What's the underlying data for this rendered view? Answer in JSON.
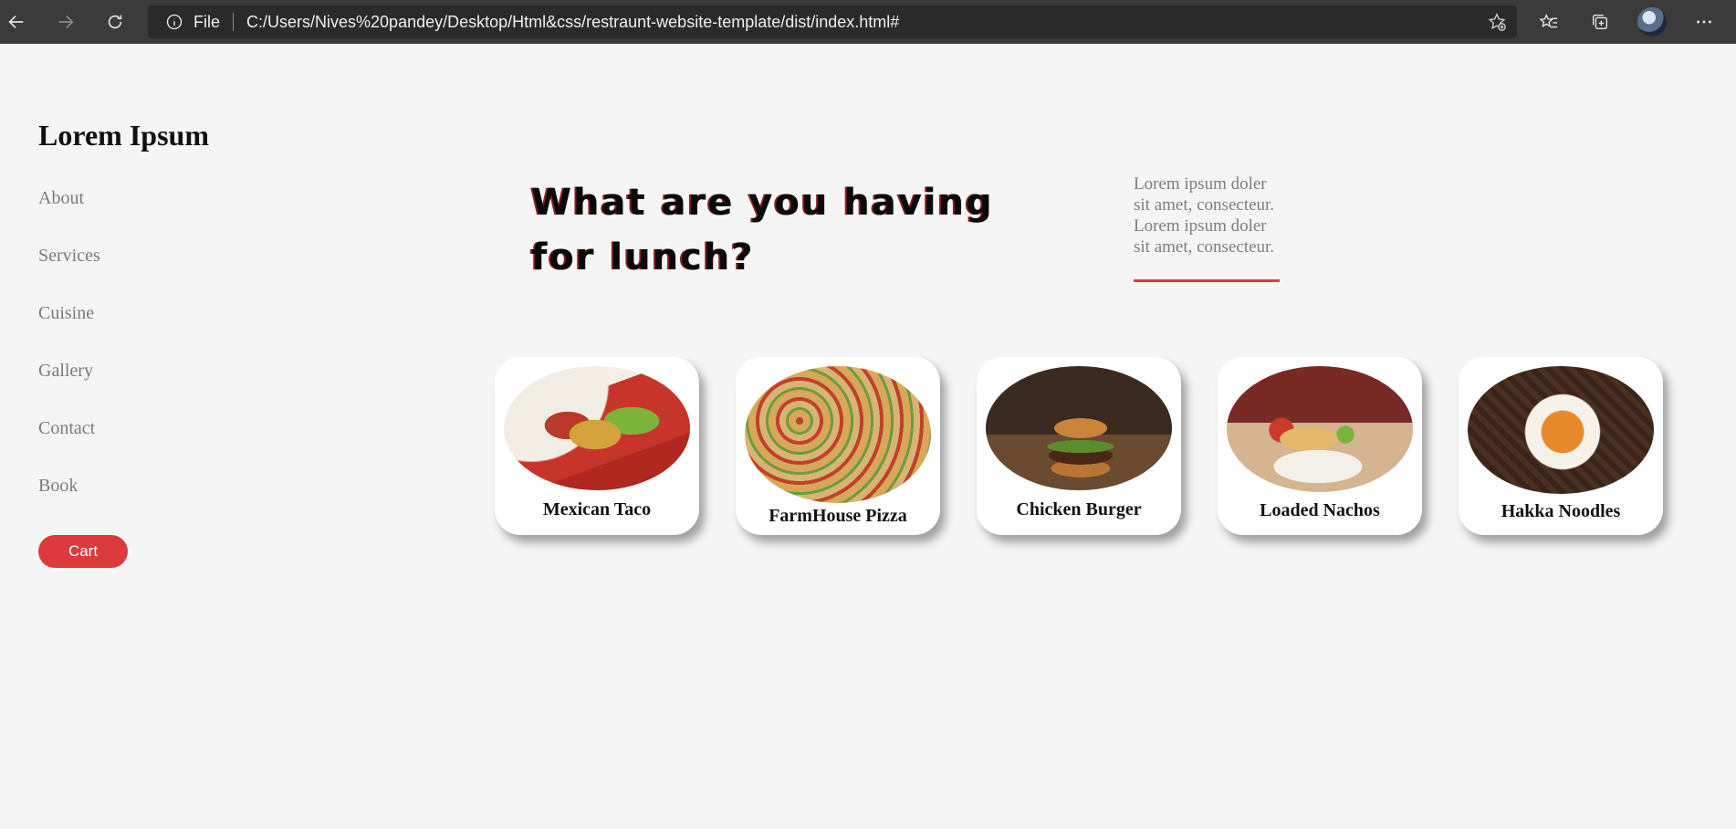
{
  "browser": {
    "file_label": "File",
    "url": "C:/Users/Nives%20pandey/Desktop/Html&css/restraunt-website-template/dist/index.html#",
    "icons": [
      "back-icon",
      "forward-icon",
      "refresh-icon",
      "info-icon",
      "add-favorite-icon",
      "favorites-icon",
      "collections-icon",
      "profile-avatar",
      "more-icon"
    ]
  },
  "sidebar": {
    "brand": "Lorem Ipsum",
    "items": [
      {
        "label": "About"
      },
      {
        "label": "Services"
      },
      {
        "label": "Cuisine"
      },
      {
        "label": "Gallery"
      },
      {
        "label": "Contact"
      },
      {
        "label": "Book"
      }
    ],
    "cart_label": "Cart"
  },
  "hero": {
    "title": "What are you having for lunch?",
    "description": "Lorem ipsum doler sit amet, consecteur. Lorem ipsum doler sit amet, consecteur."
  },
  "dishes": [
    {
      "name": "Mexican Taco"
    },
    {
      "name": "FarmHouse Pizza"
    },
    {
      "name": "Chicken Burger"
    },
    {
      "name": "Loaded Nachos"
    },
    {
      "name": "Hakka Noodles"
    }
  ],
  "colors": {
    "accent": "#dc3a3d",
    "background": "#f5f5f5",
    "browser_bar": "#3b3b3b"
  }
}
